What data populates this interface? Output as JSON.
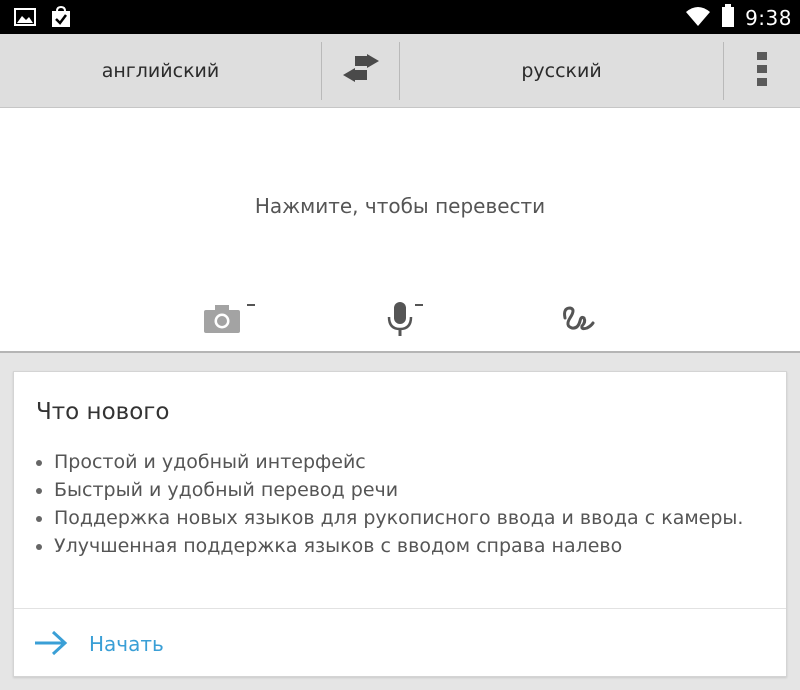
{
  "status_bar": {
    "time": "9:38",
    "icons": [
      "gallery-icon",
      "shopping-bag-check-icon",
      "wifi-icon",
      "battery-icon"
    ]
  },
  "language_bar": {
    "source_language": "английский",
    "target_language": "русский",
    "icons": [
      "swap-arrows-icon",
      "overflow-menu-icon"
    ]
  },
  "input": {
    "placeholder": "Нажмите, чтобы перевести",
    "tools": [
      "camera-icon",
      "microphone-icon",
      "handwriting-icon"
    ]
  },
  "whats_new": {
    "title": "Что нового",
    "items": [
      "Простой и удобный интерфейс",
      "Быстрый и удобный перевод речи",
      "Поддержка новых языков для рукописного ввода и ввода с камеры.",
      "Улучшенная поддержка языков с вводом справа налево"
    ],
    "start_label": "Начать"
  },
  "colors": {
    "accent": "#3a9fd6",
    "toolbar_bg": "#dedede",
    "status_bar_bg": "#000000",
    "page_bg": "#e5e5e5"
  }
}
